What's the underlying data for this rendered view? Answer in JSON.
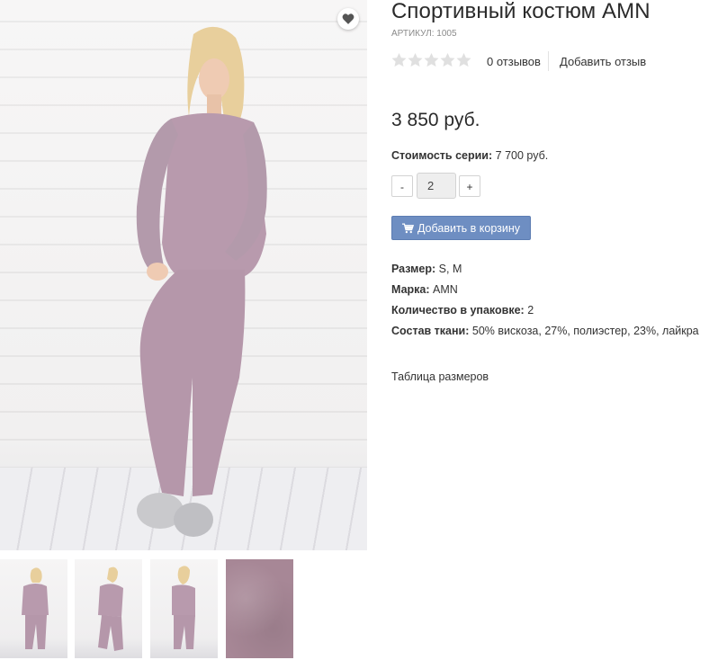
{
  "product": {
    "title": "Спортивный костюм AMN",
    "sku_label": "АРТИКУЛ: 1005",
    "rating_stars": 0,
    "rating_max": 5,
    "reviews_count": "0 отзывов",
    "add_review": "Добавить отзыв",
    "price": "3 850 руб.",
    "series_label": "Стоимость серии:",
    "series_value": "7 700 руб.",
    "quantity": "2",
    "qty_minus": "-",
    "qty_plus": "+",
    "add_to_cart": "Добавить в корзину",
    "properties": [
      {
        "label": "Размер:",
        "value": "S, M"
      },
      {
        "label": "Марка:",
        "value": "AMN"
      },
      {
        "label": "Количество в упаковке:",
        "value": "2"
      },
      {
        "label": "Состав ткани:",
        "value": "50% вискоза, 27%, полиэстер, 23%, лайкра"
      }
    ],
    "size_table_link": "Таблица размеров"
  },
  "icons": {
    "favorite": "heart-icon",
    "cart": "shopping-cart-icon",
    "star": "star-icon"
  },
  "colors": {
    "accent_button": "#6e8ec2",
    "star_empty": "#e0e0e0",
    "garment": "#b89aad",
    "thumb_fabric": "#a78796"
  }
}
